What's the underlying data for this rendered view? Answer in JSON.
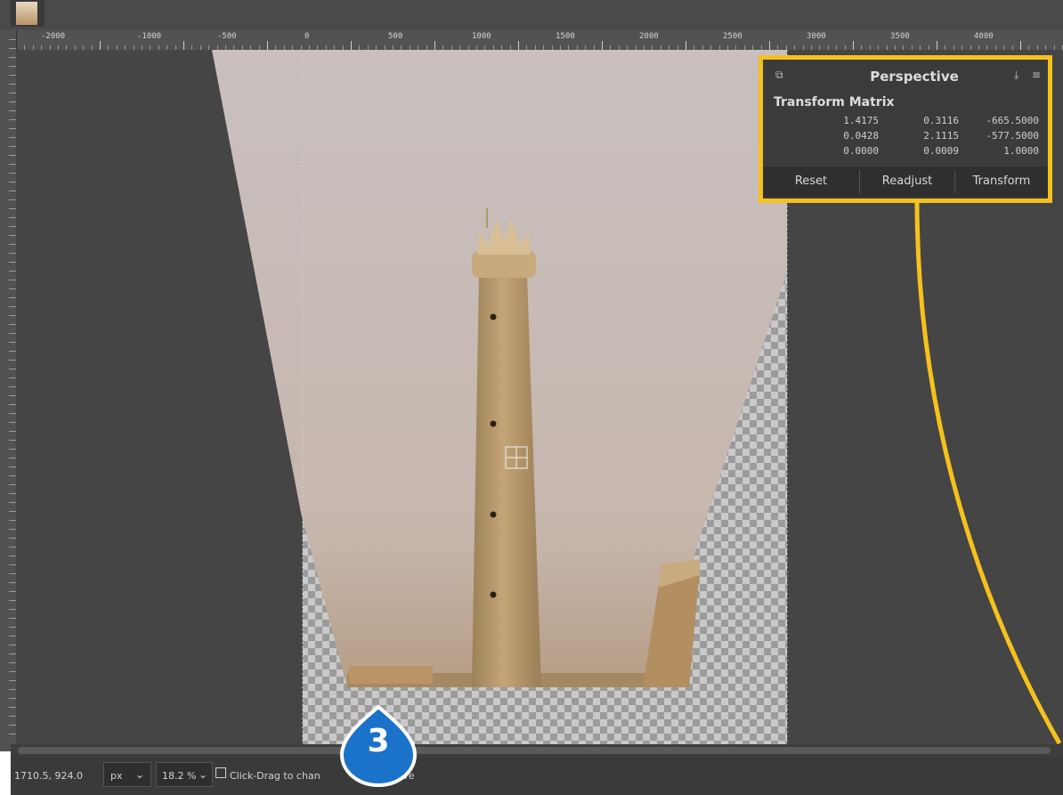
{
  "ruler": {
    "labels": [
      "-2000",
      "-1000",
      "-500",
      "0",
      "500",
      "1000",
      "1500",
      "2000",
      "2500",
      "3000",
      "3500",
      "4000"
    ]
  },
  "panel": {
    "title": "Perspective",
    "matrix_label": "Transform Matrix",
    "matrix": [
      [
        "1.4175",
        "0.3116",
        "-665.5000"
      ],
      [
        "0.0428",
        "2.1115",
        "-577.5000"
      ],
      [
        "0.0000",
        "0.0009",
        "1.0000"
      ]
    ],
    "buttons": {
      "reset": "Reset",
      "readjust": "Readjust",
      "transform": "Transform"
    }
  },
  "callout": {
    "number": "3"
  },
  "status": {
    "coords": "1710.5, 924.0",
    "unit": "px",
    "zoom": "18.2 %",
    "hint_start": "Click-Drag to chan",
    "hint_end": "ective"
  },
  "colors": {
    "highlight": "#f5c11c",
    "callout": "#1a73c9"
  },
  "icons": [
    "image-thumbnail-icon",
    "perspective-tool-icon",
    "pin-icon",
    "menu-icon",
    "crosshair-icon",
    "chevron-down-icon",
    "status-tool-icon"
  ]
}
